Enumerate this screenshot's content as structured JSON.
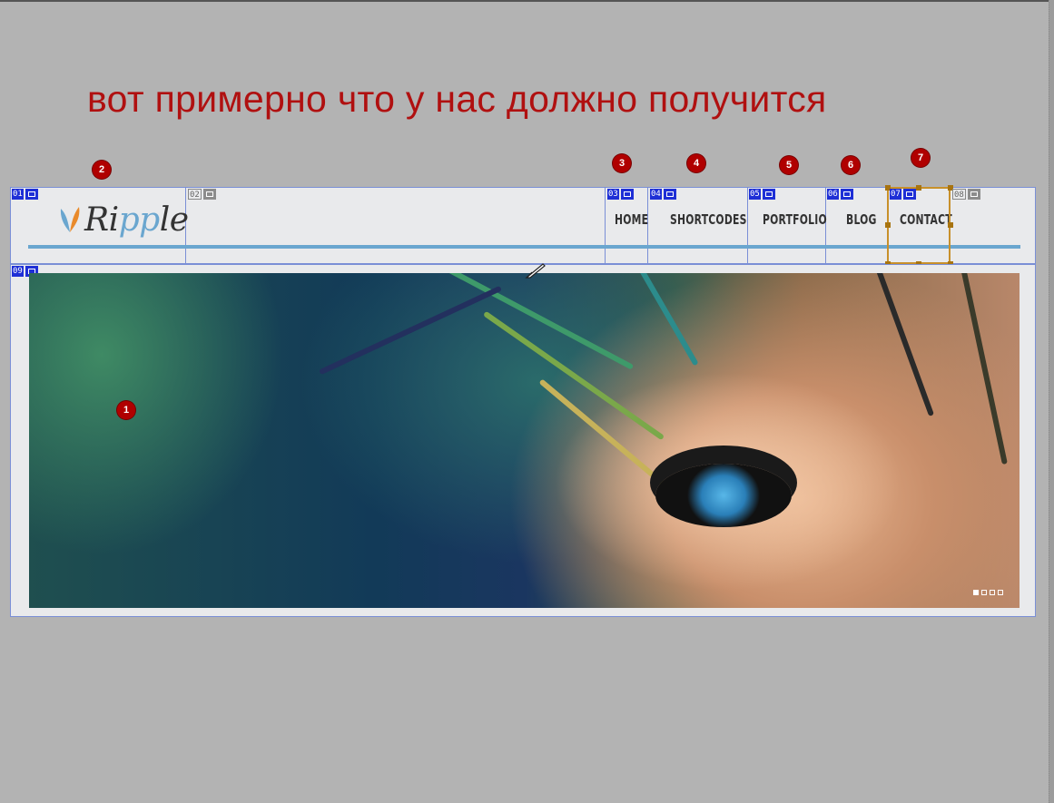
{
  "heading": "вот примерно что у нас должно получится",
  "logo": {
    "prefix": "R",
    "mid": "i",
    "pp": "pp",
    "suffix": "le"
  },
  "nav": [
    {
      "id": "home",
      "label": "HOME"
    },
    {
      "id": "shortcodes",
      "label": "SHORTCODES"
    },
    {
      "id": "portfolio",
      "label": "PORTFOLIO"
    },
    {
      "id": "blog",
      "label": "BLOG"
    },
    {
      "id": "contact",
      "label": "CONTACT"
    }
  ],
  "slices": {
    "s01": "01",
    "s02": "02",
    "s03": "03",
    "s04": "04",
    "s05": "05",
    "s06": "06",
    "s07": "07",
    "s08": "08",
    "s09": "09"
  },
  "badges": {
    "b1": "1",
    "b2": "2",
    "b3": "3",
    "b4": "4",
    "b5": "5",
    "b6": "6",
    "b7": "7"
  },
  "slider": {
    "total_slides": 4,
    "active_slide": 1
  },
  "colors": {
    "accent_blue": "#6aa6cf",
    "slice_blue": "#1e2fd6",
    "badge_red": "#b00000",
    "heading_red": "#b01010",
    "selection": "#c8902a"
  }
}
